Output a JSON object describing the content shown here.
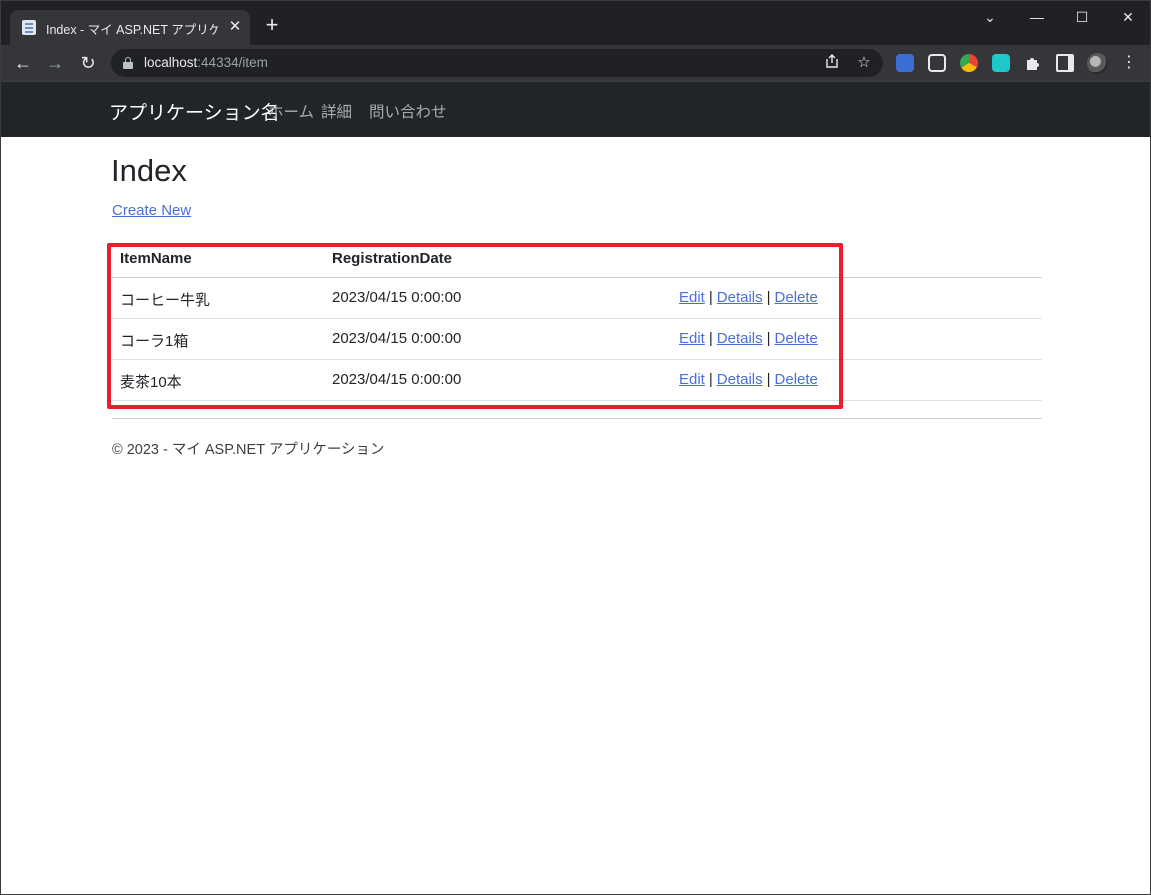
{
  "browser": {
    "tab": {
      "title": "Index - マイ ASP.NET アプリケーション",
      "close": "✕"
    },
    "new_tab": "+",
    "window_controls": {
      "dropdown": "⌄",
      "minimize": "—",
      "maximize": "☐",
      "close": "✕"
    },
    "nav": {
      "back": "←",
      "forward": "→",
      "reload": "↻"
    },
    "address": {
      "host": "localhost",
      "rest": ":44334/item"
    },
    "icons": [
      "share-icon",
      "bookmark-star-icon",
      "translate-extension-icon",
      "media-extension-icon",
      "chrome-color-extension-icon",
      "teal-extension-icon",
      "puzzle-extensions-icon",
      "side-panel-icon",
      "profile-avatar",
      "menu-dots-icon"
    ]
  },
  "site": {
    "brand": "アプリケーション名",
    "nav": [
      "ホーム",
      "詳細",
      "問い合わせ"
    ]
  },
  "main": {
    "title": "Index",
    "create_link": "Create New",
    "table": {
      "headers": [
        "ItemName",
        "RegistrationDate",
        ""
      ],
      "rows": [
        {
          "name": "コーヒー牛乳",
          "date": "2023/04/15 0:00:00"
        },
        {
          "name": "コーラ1箱",
          "date": "2023/04/15 0:00:00"
        },
        {
          "name": "麦茶10本",
          "date": "2023/04/15 0:00:00"
        }
      ],
      "actions": {
        "edit": "Edit",
        "details": "Details",
        "delete": "Delete",
        "separator": "|"
      }
    }
  },
  "footer": {
    "text": "© 2023 - マイ ASP.NET アプリケーション"
  },
  "colors": {
    "highlight": "#e8202a",
    "link": "#4a6fd9",
    "navbar": "#212529"
  }
}
